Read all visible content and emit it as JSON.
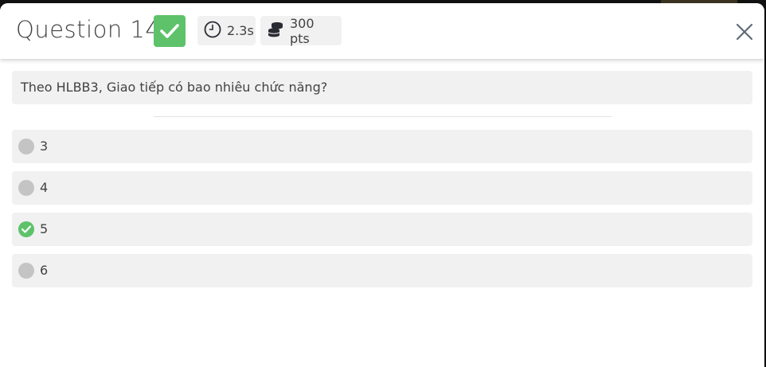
{
  "header": {
    "title": "Question 14",
    "time": "2.3s",
    "points": "300 pts",
    "status_color": "#5ec26a",
    "status": "correct",
    "icons": {
      "status": "checkmark-icon",
      "time": "stopwatch-icon",
      "points": "coins-icon",
      "close": "close-icon"
    }
  },
  "question": {
    "text": "Theo HLBB3, Giao tiếp có bao nhiêu chức năng?"
  },
  "options": [
    {
      "label": "3",
      "correct": false
    },
    {
      "label": "4",
      "correct": false
    },
    {
      "label": "5",
      "correct": true
    },
    {
      "label": "6",
      "correct": false
    }
  ]
}
